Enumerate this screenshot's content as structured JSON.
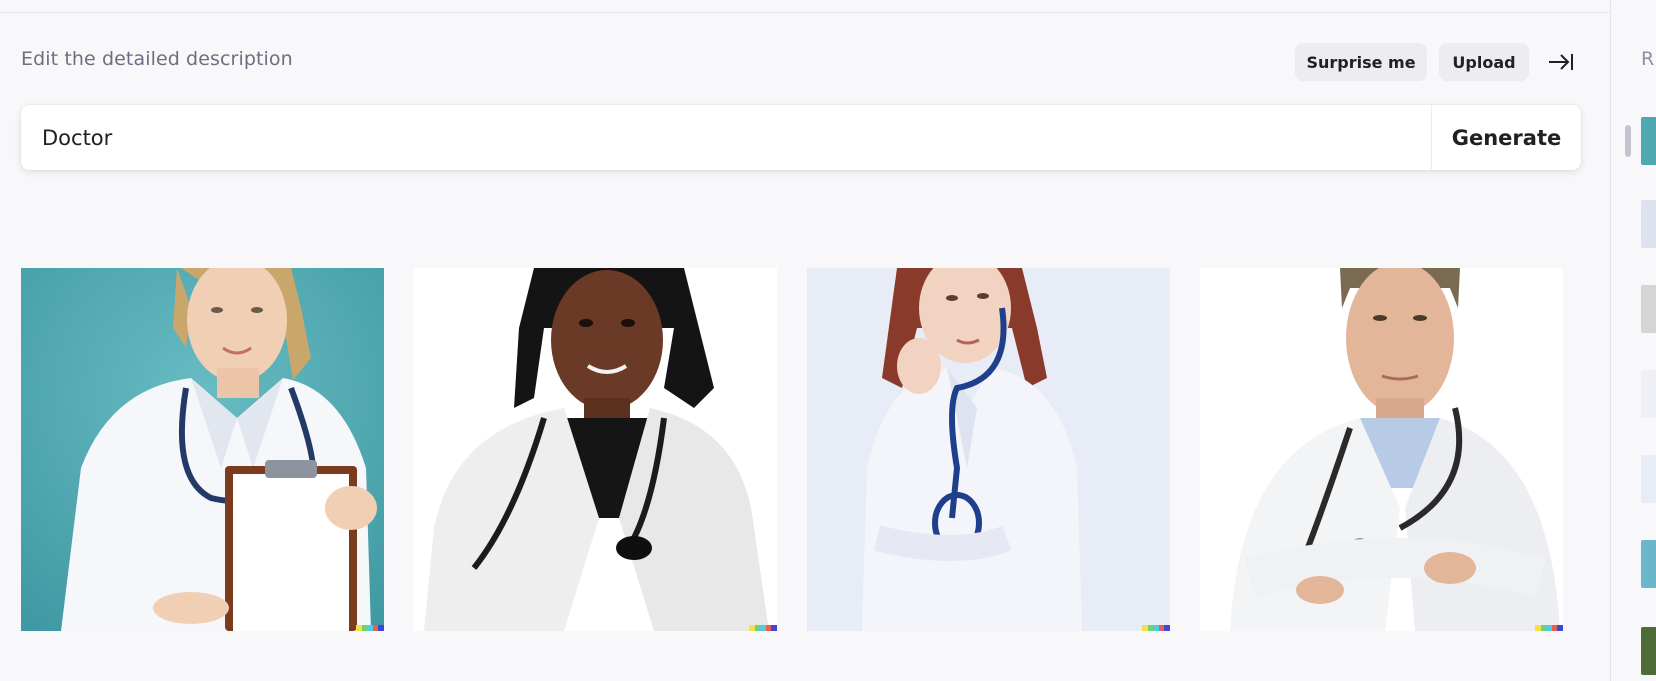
{
  "header": {
    "description_label": "Edit the detailed description",
    "surprise_label": "Surprise me",
    "upload_label": "Upload",
    "collapse_icon": "collapse-to-right-icon"
  },
  "prompt": {
    "value": "Doctor",
    "generate_label": "Generate"
  },
  "results": [
    {
      "subject": "female doctor holding clipboard",
      "background": "#4fa8b0"
    },
    {
      "subject": "female doctor with stethoscope",
      "background": "#ffffff"
    },
    {
      "subject": "female doctor holding stethoscope",
      "background": "#e8ecf6"
    },
    {
      "subject": "male doctor with crossed arms",
      "background": "#ffffff"
    }
  ],
  "signature_colors": [
    "#f4e04d",
    "#6fd36f",
    "#4ecfe0",
    "#ef5d4f",
    "#3f46d8"
  ],
  "right_rail": {
    "header_partial": "R",
    "thumbnails": [
      {
        "color": "#4fa8b0"
      },
      {
        "color": "#dde3ee"
      },
      {
        "color": "#d5d5d5"
      },
      {
        "color": "#eef0f6"
      },
      {
        "color": "#e8ecf6"
      },
      {
        "color": "#6bb7c9"
      },
      {
        "color": "#4e6b3a"
      }
    ]
  }
}
